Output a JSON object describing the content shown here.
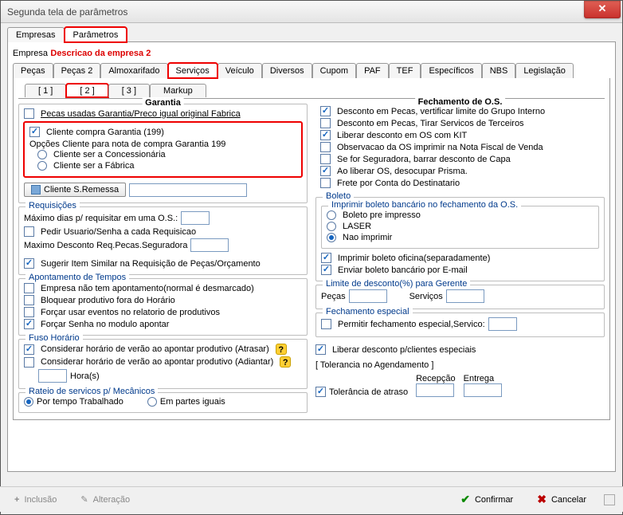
{
  "window": {
    "title": "Segunda tela de parâmetros"
  },
  "primary_tabs": {
    "empresas": "Empresas",
    "parametros": "Parâmetros"
  },
  "empresa": {
    "label": "Empresa",
    "desc": "Descricao da empresa 2"
  },
  "secondary_tabs": [
    "Peças",
    "Peças 2",
    "Almoxarifado",
    "Serviços",
    "Veículo",
    "Diversos",
    "Cupom",
    "PAF",
    "TEF",
    "Específicos",
    "NBS",
    "Legislação"
  ],
  "tertiary_tabs": [
    "[ 1 ]",
    "[ 2 ]",
    "[ 3 ]",
    "Markup"
  ],
  "left": {
    "garantia": {
      "title": "Garantia",
      "pecas_usadas": "Pecas usadas Garantia/Preco igual original Fabrica",
      "cliente_compra": "Cliente compra Garantia (199)",
      "opcoes_legend": "Opções Cliente para nota de compra Garantia 199",
      "concess": "Cliente ser a Concessionária",
      "fabrica": "Cliente ser a Fábrica",
      "btn_sremessa": "Cliente S.Remessa"
    },
    "requisicoes": {
      "title": "Requisições",
      "max_dias": "Máximo dias p/ requisitar em uma O.S.:",
      "pedir_usuario": "Pedir Usuario/Senha a cada Requisicao",
      "max_desc": "Maximo Desconto Req.Pecas.Seguradora",
      "sugerir": "Sugerir Item Similar na Requisição de Peças/Orçamento"
    },
    "apontamento": {
      "title": "Apontamento de Tempos",
      "sem_apont": "Empresa não tem apontamento(normal é desmarcado)",
      "bloquear": "Bloquear produtivo fora do Horário",
      "forcar_eventos": "Forçar usar eventos no relatorio de produtivos",
      "forcar_senha": "Forçar Senha no modulo apontar"
    },
    "fuso": {
      "title": "Fuso Horário",
      "atrasar": "Considerar horário de verão ao apontar produtivo (Atrasar)",
      "adiantar": "Considerar horário de verão ao apontar produtivo (Adiantar)",
      "horas": "Hora(s)"
    },
    "rateio": {
      "title": "Rateio de servicos p/ Mecânicos",
      "tempo": "Por tempo Trabalhado",
      "partes": "Em partes iguais"
    }
  },
  "right": {
    "fechamento": {
      "title": "Fechamento de O.S.",
      "desc_pecas_grupo": "Desconto em Pecas, vertificar limite do Grupo Interno",
      "desc_pecas_terc": "Desconto em Pecas, Tirar Servicos de Terceiros",
      "liberar_kit": "Liberar desconto em OS com KIT",
      "obs_nf": "Observacao da OS imprimir na Nota Fiscal de Venda",
      "seguradora": "Se for Seguradora, barrar desconto de Capa",
      "desocupar": "Ao liberar OS, desocupar Prisma.",
      "frete": "Frete por Conta do Destinatario"
    },
    "boleto": {
      "title": "Boleto",
      "imprimir_legend": "Imprimir boleto bancário no fechamento da O.S.",
      "pre": "Boleto pre impresso",
      "laser": "LASER",
      "nao": "Nao imprimir",
      "oficina": "Imprimir boleto oficina(separadamente)",
      "email": "Enviar boleto bancário por E-mail"
    },
    "limite": {
      "title": "Limite de desconto(%) para Gerente",
      "pecas": "Peças",
      "servicos": "Serviços"
    },
    "fech_especial": {
      "title": "Fechamento especial",
      "permitir": "Permitir fechamento especial,Servico:"
    },
    "liberar_cli": "Liberar desconto p/clientes especiais",
    "tolerancia": {
      "title": "[ Tolerancia no Agendamento ]",
      "atraso": "Tolerância de atraso",
      "recepcao": "Recepção",
      "entrega": "Entrega"
    }
  },
  "footer": {
    "inclusao": "Inclusão",
    "alteracao": "Alteração",
    "confirmar": "Confirmar",
    "cancelar": "Cancelar"
  }
}
